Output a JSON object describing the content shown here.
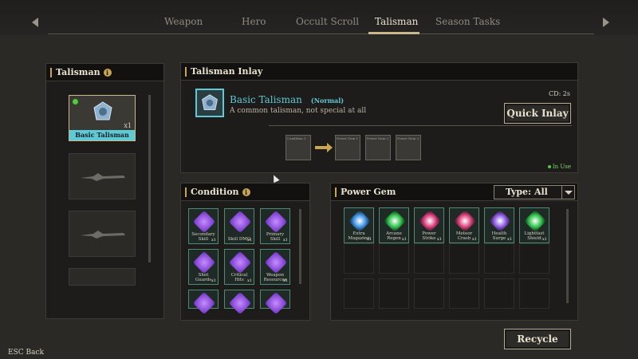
{
  "nav": {
    "tabs": [
      "Weapon",
      "Hero",
      "Occult Scroll",
      "Talisman",
      "Season Tasks"
    ],
    "active_tab": "Talisman"
  },
  "talisman_panel": {
    "title": "Talisman",
    "info_icon": "info-icon",
    "items": [
      {
        "label": "Basic Talisman",
        "count": "x1",
        "selected": true,
        "icon": "talisman-icon"
      },
      {
        "label": "",
        "count": "",
        "selected": false,
        "icon": "locked-weapon-silhouette-icon"
      },
      {
        "label": "",
        "count": "",
        "selected": false,
        "icon": "locked-weapon-silhouette-icon"
      }
    ]
  },
  "inlay_panel": {
    "title": "Talisman Inlay",
    "name": "Basic Talisman",
    "rarity": "(Normal)",
    "description": "A common talisman, not special at all",
    "cd": "CD: 2s",
    "quick_inlay_label": "Quick Inlay",
    "in_use_label": "In Use",
    "sockets": [
      "Condition 1",
      "Power Gem 1",
      "Power Gem 2",
      "Power Gem 3"
    ]
  },
  "condition_panel": {
    "title": "Condition",
    "items": [
      {
        "label": "Secondary Skill",
        "count": "x1"
      },
      {
        "label": "Skill DMG",
        "count": "x1"
      },
      {
        "label": "Primary Skill",
        "count": "x1"
      },
      {
        "label": "Shot Guards",
        "count": "x1"
      },
      {
        "label": "Critical Hits",
        "count": "x1"
      },
      {
        "label": "Weapon Resources",
        "count": "x1"
      },
      {
        "label": "",
        "count": ""
      },
      {
        "label": "",
        "count": ""
      },
      {
        "label": "",
        "count": ""
      }
    ]
  },
  "power_gem_panel": {
    "title": "Power Gem",
    "filter_label": "Type: All",
    "items": [
      {
        "label": "Extra Magazine",
        "count": "x1",
        "color": "#3a8fe0"
      },
      {
        "label": "Arcane Regen",
        "count": "x1",
        "color": "#2ec24a"
      },
      {
        "label": "Power Strike",
        "count": "x1",
        "color": "#d83a7a"
      },
      {
        "label": "Meteor Crash",
        "count": "x1",
        "color": "#d8407a"
      },
      {
        "label": "Health Surge",
        "count": "x1",
        "color": "#8a56e0"
      },
      {
        "label": "Lightfast Shield",
        "count": "x1",
        "color": "#2ec24a"
      }
    ]
  },
  "footer": {
    "recycle_label": "Recycle",
    "esc_key": "ESC",
    "back_label": "Back"
  }
}
